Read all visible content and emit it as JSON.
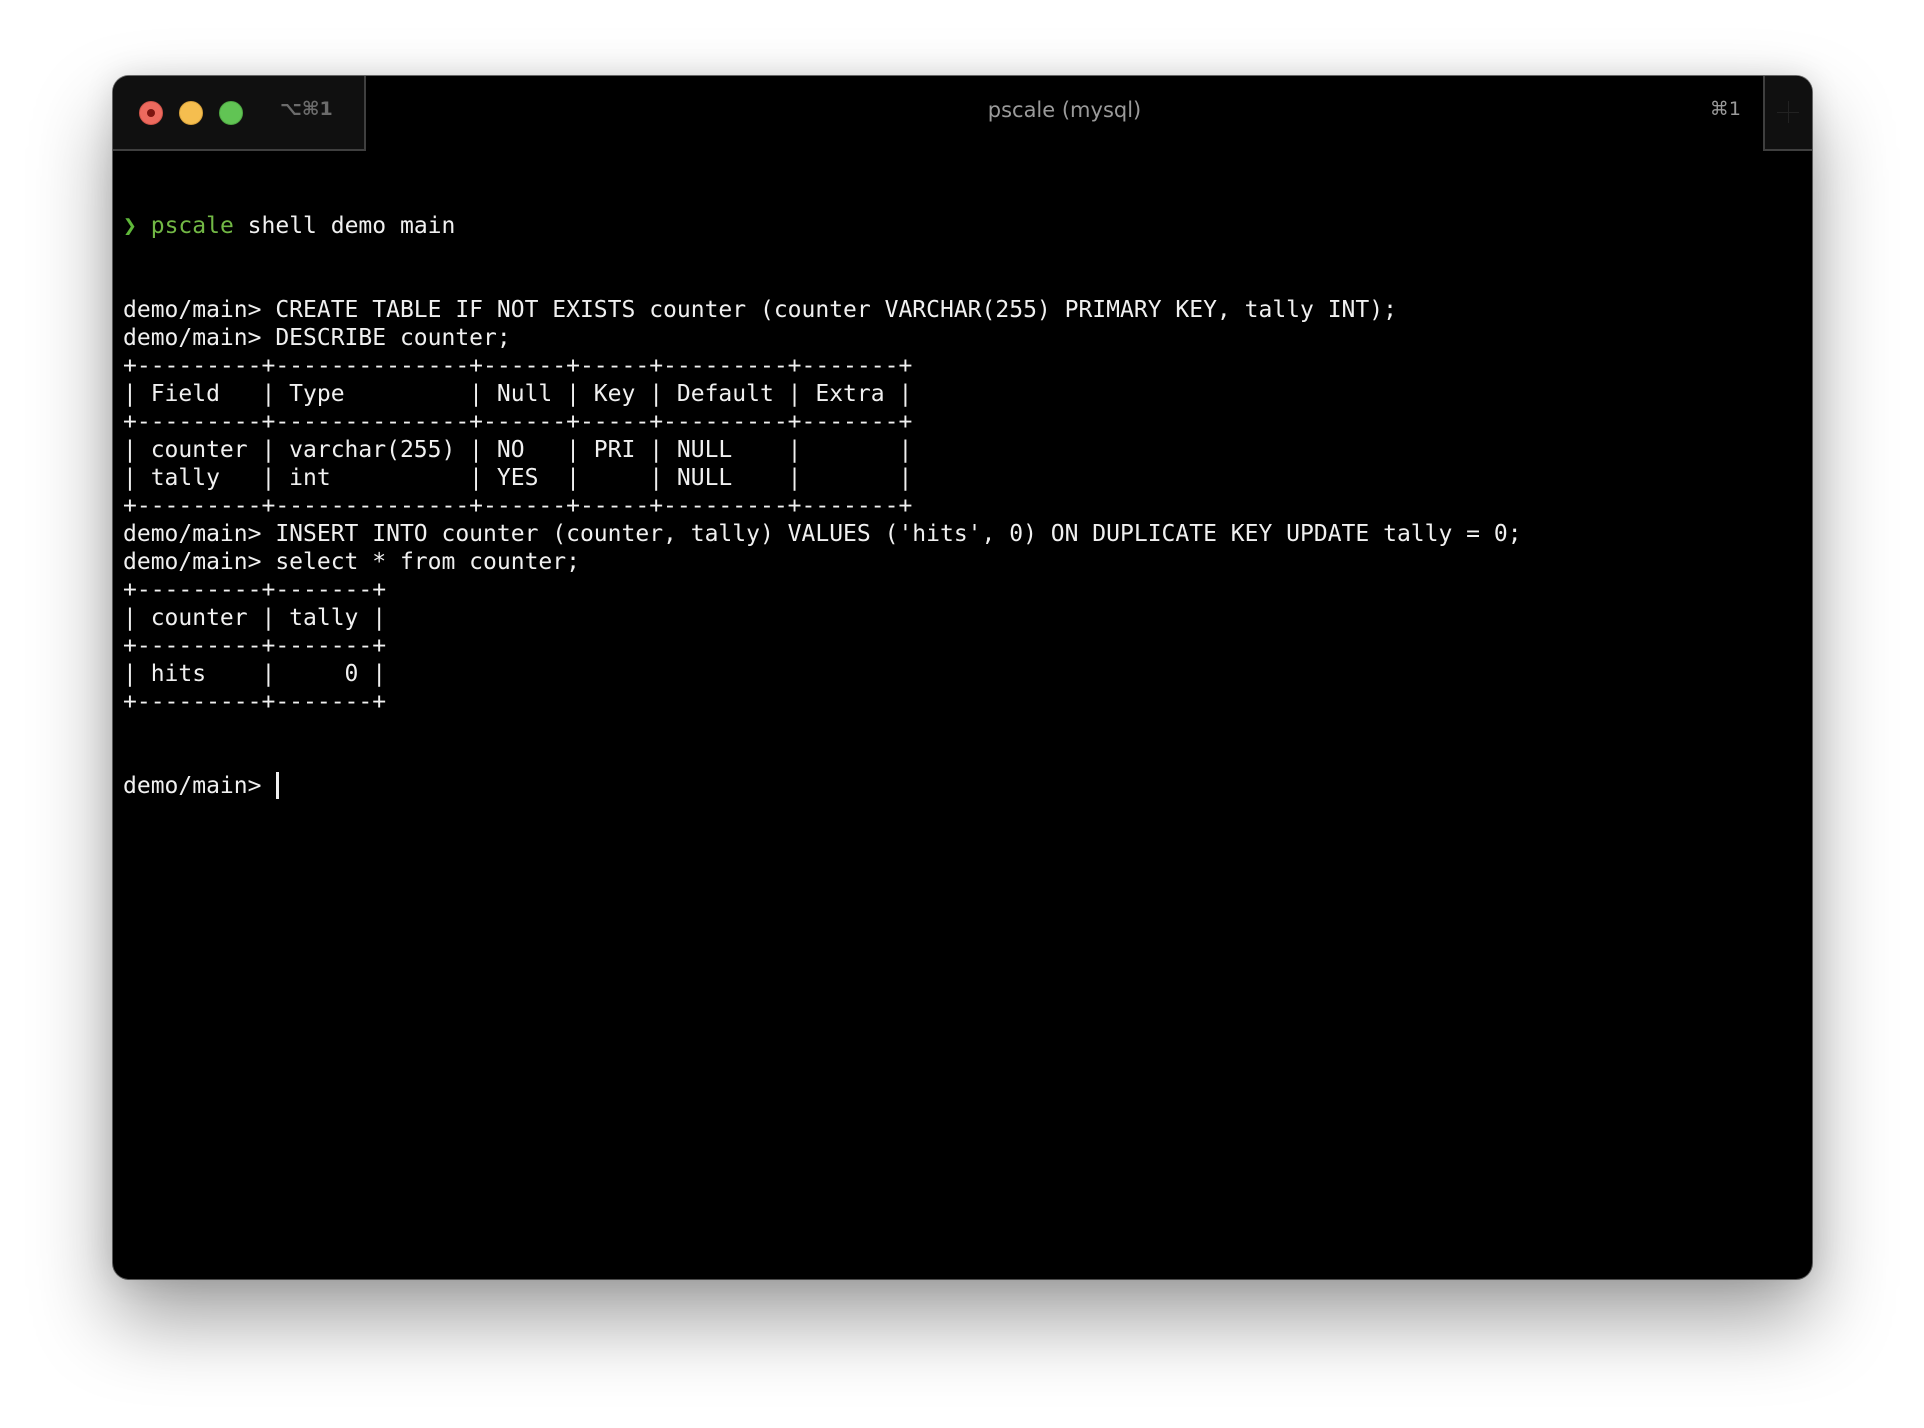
{
  "window": {
    "title": "pscale (mysql)",
    "traffic_lights": [
      "close",
      "minimize",
      "zoom"
    ],
    "tabs": [
      {
        "shortcut": "⌥⌘1",
        "active": false
      },
      {
        "title": "pscale (mysql)",
        "shortcut": "⌘1",
        "active": true
      }
    ],
    "new_tab_icon": "plus-icon"
  },
  "colors": {
    "terminal_bg": "#000000",
    "text": "#f0f0f0",
    "prompt_green": "#5fb83a",
    "command_green": "#72b845",
    "close": "#ed6a5e",
    "minimize": "#f5be4f",
    "maximize": "#61c454"
  },
  "terminal": {
    "shell_prompt": {
      "arrow": "❯",
      "command": "pscale",
      "args": " shell demo main"
    },
    "lines": [
      "demo/main> CREATE TABLE IF NOT EXISTS counter (counter VARCHAR(255) PRIMARY KEY, tally INT);",
      "demo/main> DESCRIBE counter;",
      "+---------+--------------+------+-----+---------+-------+",
      "| Field   | Type         | Null | Key | Default | Extra |",
      "+---------+--------------+------+-----+---------+-------+",
      "| counter | varchar(255) | NO   | PRI | NULL    |       |",
      "| tally   | int          | YES  |     | NULL    |       |",
      "+---------+--------------+------+-----+---------+-------+",
      "demo/main> INSERT INTO counter (counter, tally) VALUES ('hits', 0) ON DUPLICATE KEY UPDATE tally = 0;",
      "demo/main> select * from counter;",
      "+---------+-------+",
      "| counter | tally |",
      "+---------+-------+",
      "| hits    |     0 |",
      "+---------+-------+"
    ],
    "current_prompt": "demo/main> ",
    "describe_table": {
      "columns": [
        "Field",
        "Type",
        "Null",
        "Key",
        "Default",
        "Extra"
      ],
      "rows": [
        [
          "counter",
          "varchar(255)",
          "NO",
          "PRI",
          "NULL",
          ""
        ],
        [
          "tally",
          "int",
          "YES",
          "",
          "NULL",
          ""
        ]
      ]
    },
    "select_table": {
      "columns": [
        "counter",
        "tally"
      ],
      "rows": [
        [
          "hits",
          "0"
        ]
      ]
    }
  }
}
